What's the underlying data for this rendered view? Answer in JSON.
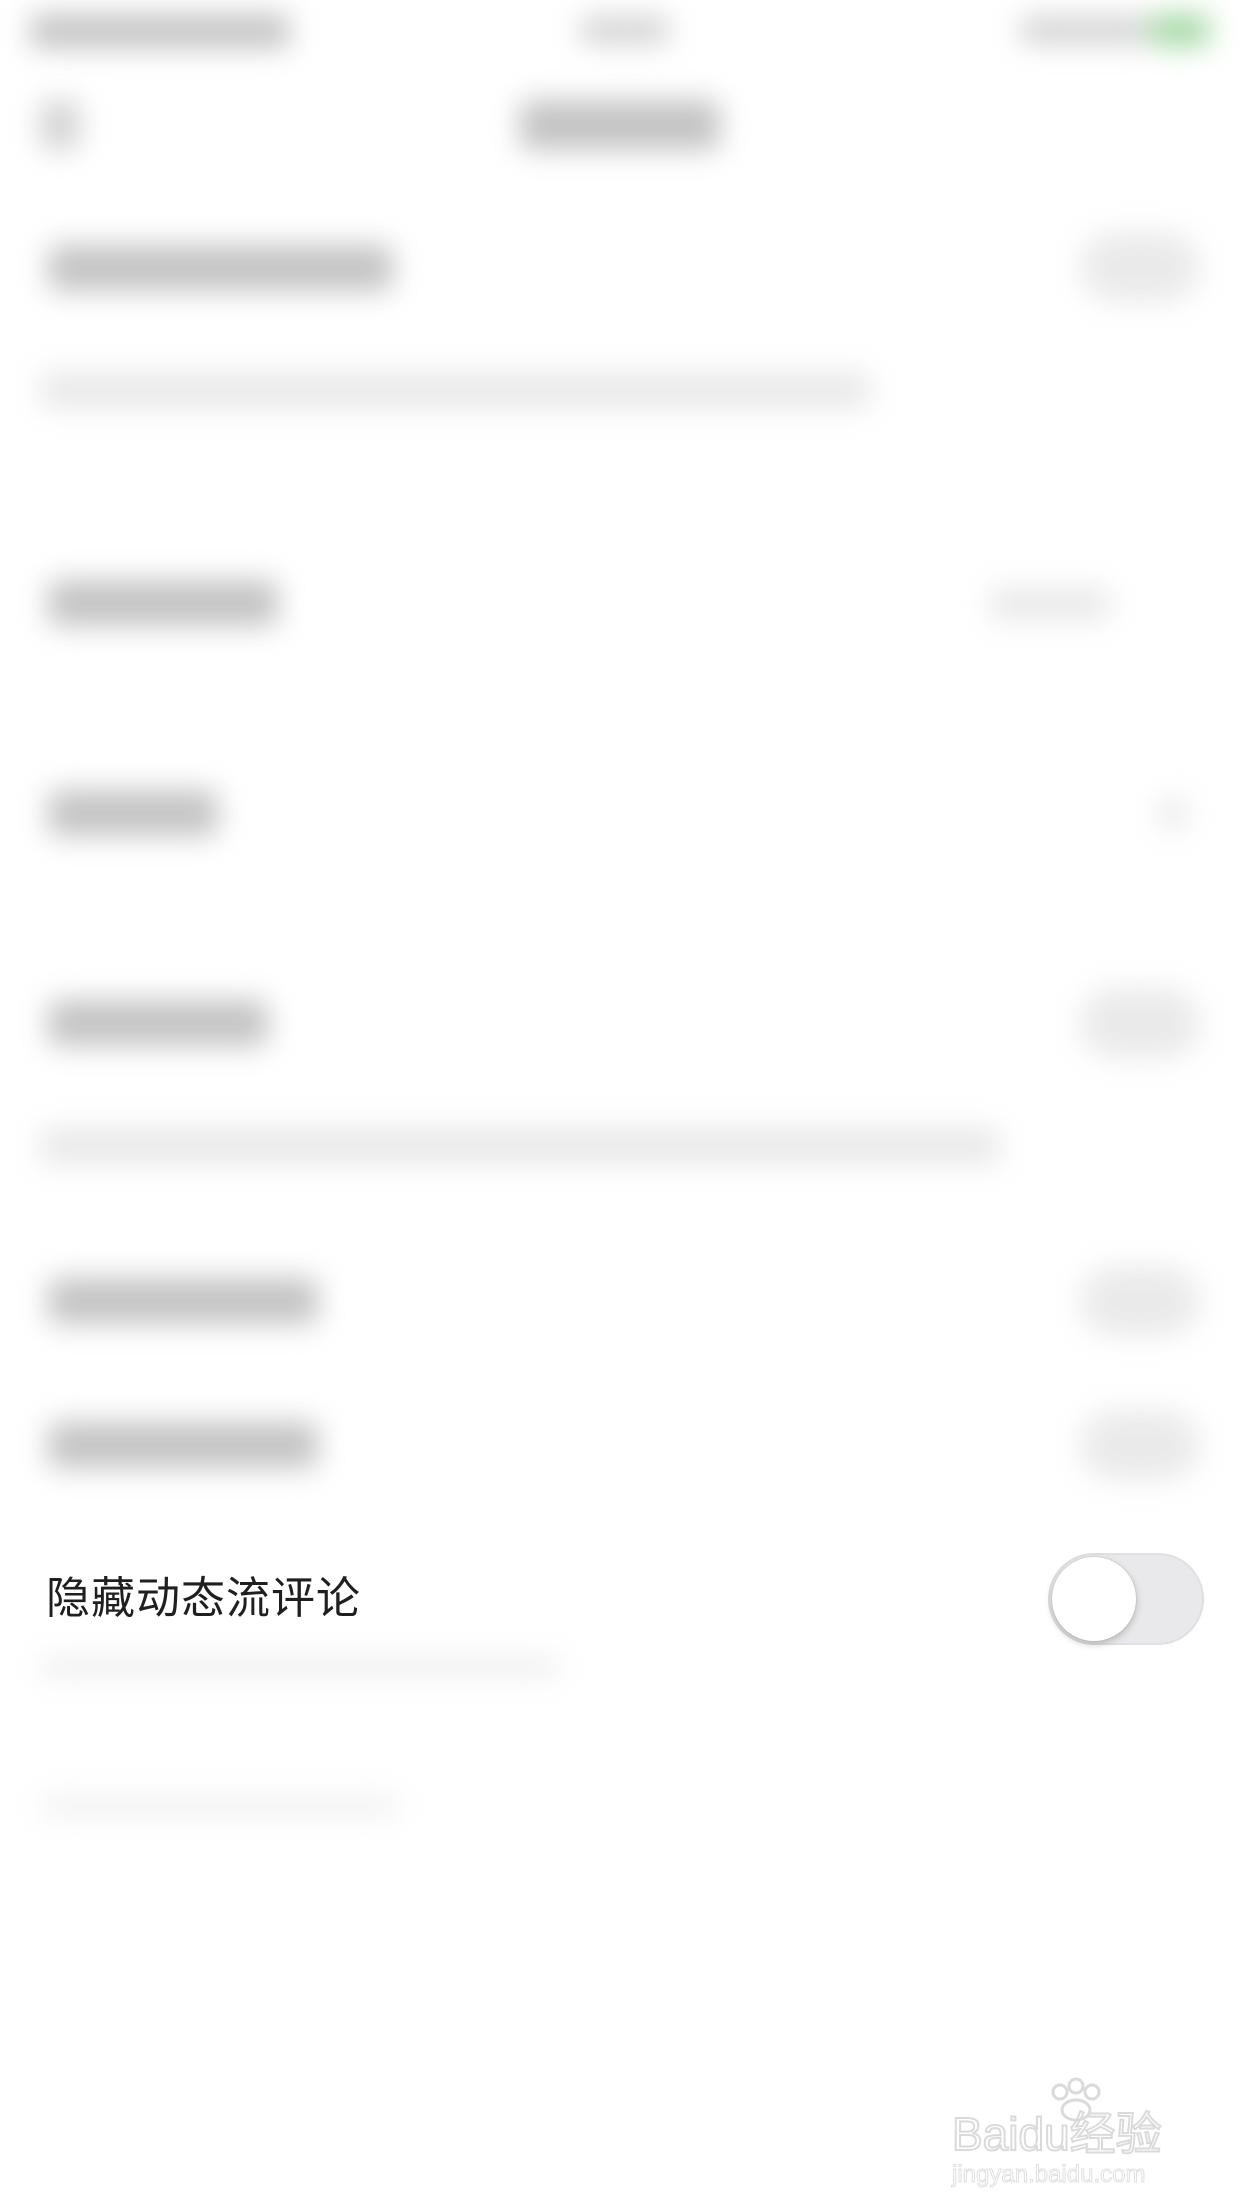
{
  "settings": {
    "hide_feed_comments": {
      "label": "隐藏动态流评论",
      "enabled": false
    }
  },
  "colors": {
    "toggle_off_track": "#e9e9eb",
    "toggle_knob": "#ffffff",
    "label_text": "#1f1f1f",
    "background": "#ffffff"
  },
  "watermark": {
    "brand_text": "Baidu经验",
    "url_text": "jingyan.baidu.com"
  }
}
